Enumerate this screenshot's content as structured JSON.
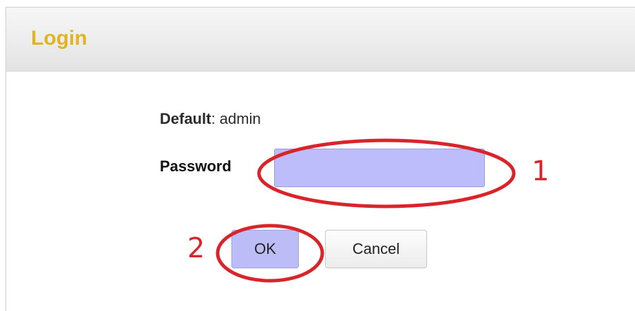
{
  "dialog": {
    "title": "Login"
  },
  "form": {
    "default_label": "Default",
    "default_value": ": admin",
    "password_label": "Password",
    "password_value": ""
  },
  "buttons": {
    "ok_label": "OK",
    "cancel_label": "Cancel"
  },
  "annotations": {
    "step_1": "1",
    "step_2": "2",
    "highlight_color": "#d8242a",
    "fill_color": "#bdbdfb"
  }
}
